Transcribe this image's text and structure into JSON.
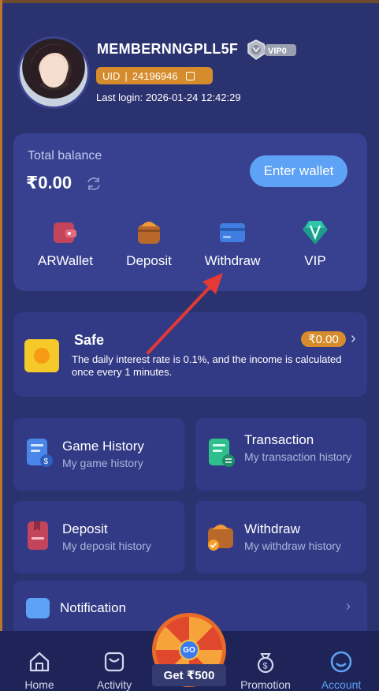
{
  "header": {
    "username": "MEMBERNNGPLL5F",
    "vip_badge": "VIP0",
    "uid_label": "UID",
    "uid_separator": "|",
    "uid_value": "24196946",
    "last_login": "Last login: 2026-01-24 12:42:29"
  },
  "balance": {
    "label": "Total balance",
    "amount": "₹0.00",
    "enter_wallet": "Enter wallet",
    "actions": [
      {
        "label": "ARWallet",
        "icon": "wallet-icon"
      },
      {
        "label": "Deposit",
        "icon": "deposit-icon"
      },
      {
        "label": "Withdraw",
        "icon": "withdraw-card-icon"
      },
      {
        "label": "VIP",
        "icon": "vip-diamond-icon"
      }
    ]
  },
  "safe": {
    "title": "Safe",
    "amount": "₹0.00",
    "description": "The daily interest rate is 0.1%, and the income is calculated once every 1 minutes."
  },
  "history": [
    {
      "title": "Game History",
      "subtitle": "My game history",
      "icon": "game-history-icon"
    },
    {
      "title": "Transaction",
      "subtitle": "My transaction history",
      "icon": "transaction-icon"
    },
    {
      "title": "Deposit",
      "subtitle": "My deposit history",
      "icon": "deposit-history-icon"
    },
    {
      "title": "Withdraw",
      "subtitle": "My withdraw history",
      "icon": "withdraw-history-icon"
    }
  ],
  "notification": {
    "label": "Notification"
  },
  "promo": {
    "go": "GO",
    "get_label": "Get ₹500"
  },
  "nav": [
    {
      "label": "Home",
      "icon": "home-icon"
    },
    {
      "label": "Activity",
      "icon": "activity-icon"
    },
    {
      "label": "Promotion",
      "icon": "promotion-icon"
    },
    {
      "label": "Account",
      "icon": "account-icon",
      "active": true
    }
  ],
  "colors": {
    "background": "#2b3270",
    "card": "#374190",
    "accent_blue": "#5ea2f5",
    "accent_orange": "#d68c2d",
    "annotation_arrow": "#e53935"
  }
}
